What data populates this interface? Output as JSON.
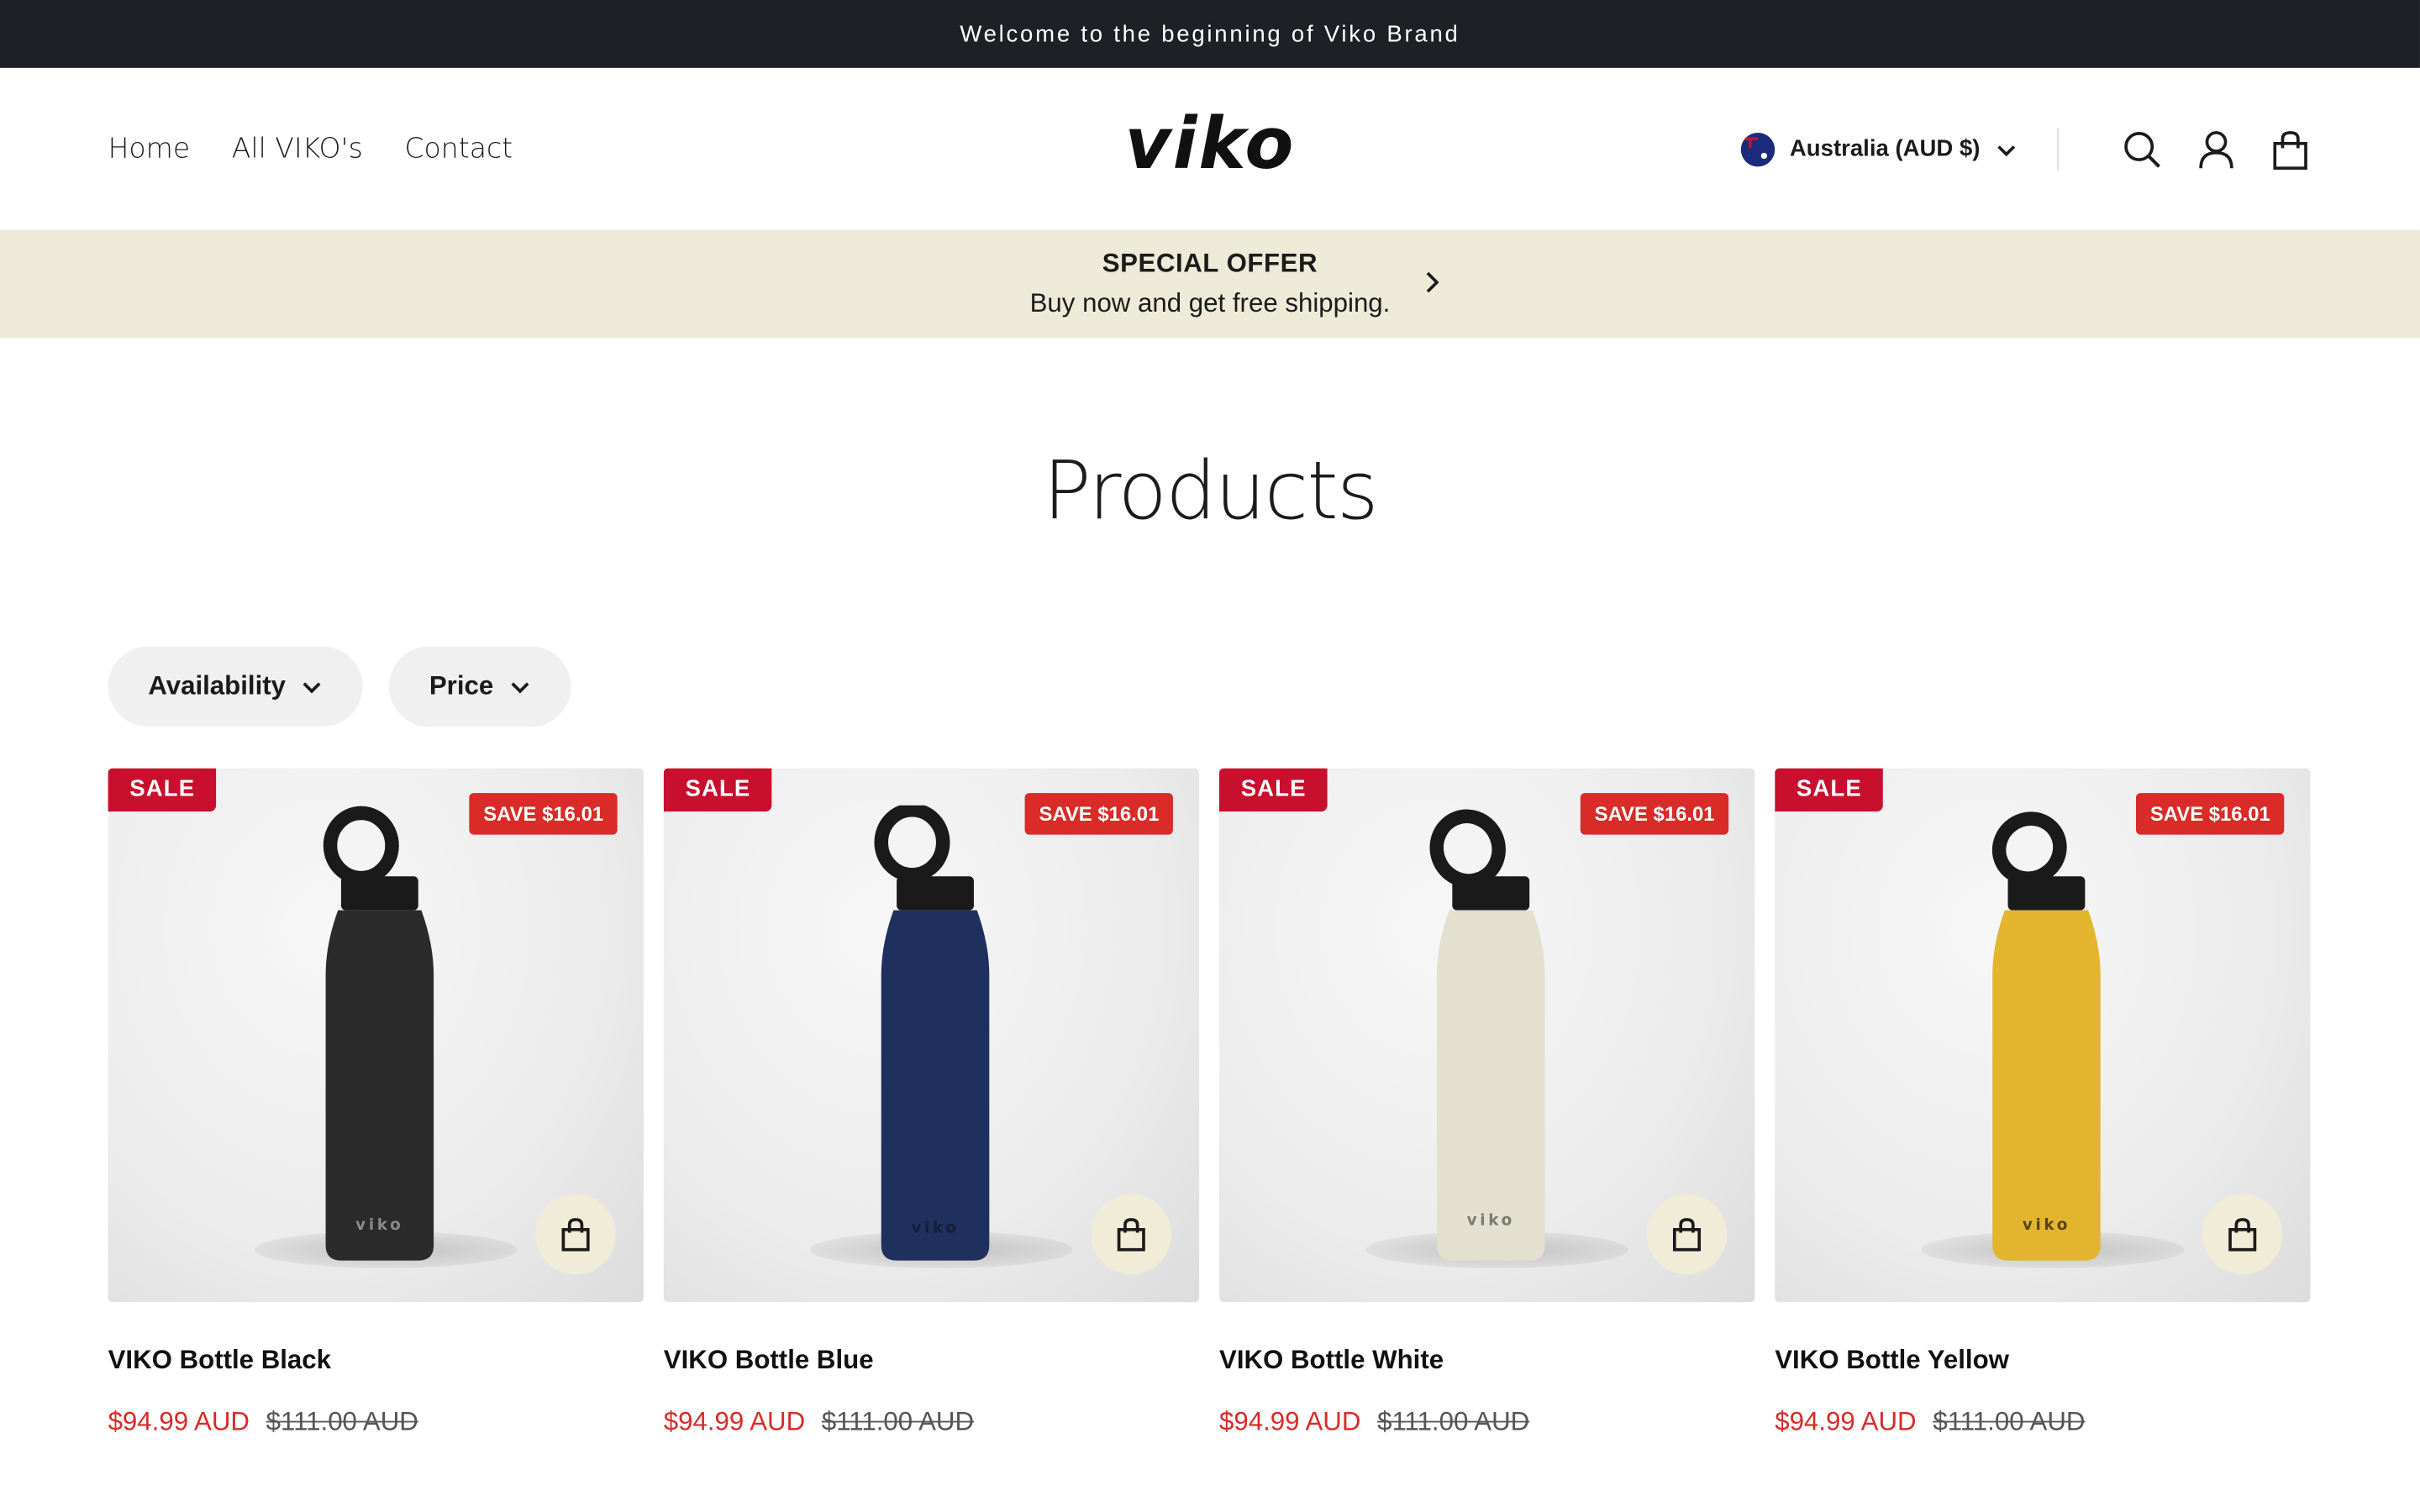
{
  "announcement": "Welcome to the beginning of Viko Brand",
  "nav": {
    "home": "Home",
    "all": "All VIKO's",
    "contact": "Contact"
  },
  "logo": "viko",
  "country": {
    "label": "Australia (AUD $)",
    "flag_icon": "australia-flag-icon"
  },
  "offer": {
    "title": "SPECIAL OFFER",
    "text": "Buy now and get free shipping."
  },
  "page_title": "Products",
  "filters": {
    "availability": "Availability",
    "price": "Price"
  },
  "products": [
    {
      "sale": "SALE",
      "save": "SAVE $16.01",
      "name": "VIKO Bottle Black",
      "price": "$94.99 AUD",
      "compare": "$111.00 AUD",
      "color": "#2b2b2b",
      "mark": "#8a8a8a"
    },
    {
      "sale": "SALE",
      "save": "SAVE $16.01",
      "name": "VIKO Bottle Blue",
      "price": "$94.99 AUD",
      "compare": "$111.00 AUD",
      "color": "#1f2f5e",
      "mark": "#151d38"
    },
    {
      "sale": "SALE",
      "save": "SAVE $16.01",
      "name": "VIKO Bottle White",
      "price": "$94.99 AUD",
      "compare": "$111.00 AUD",
      "color": "#e3e0cf",
      "mark": "#7a7a70"
    },
    {
      "sale": "SALE",
      "save": "SAVE $16.01",
      "name": "VIKO Bottle Yellow",
      "price": "$94.99 AUD",
      "compare": "$111.00 AUD",
      "color": "#e3b52e",
      "mark": "#5a4610"
    }
  ],
  "colors": {
    "sale_red": "#c8102e",
    "price_red": "#d92b27",
    "offer_bg": "#eeead8",
    "announce_bg": "#1e2026"
  }
}
